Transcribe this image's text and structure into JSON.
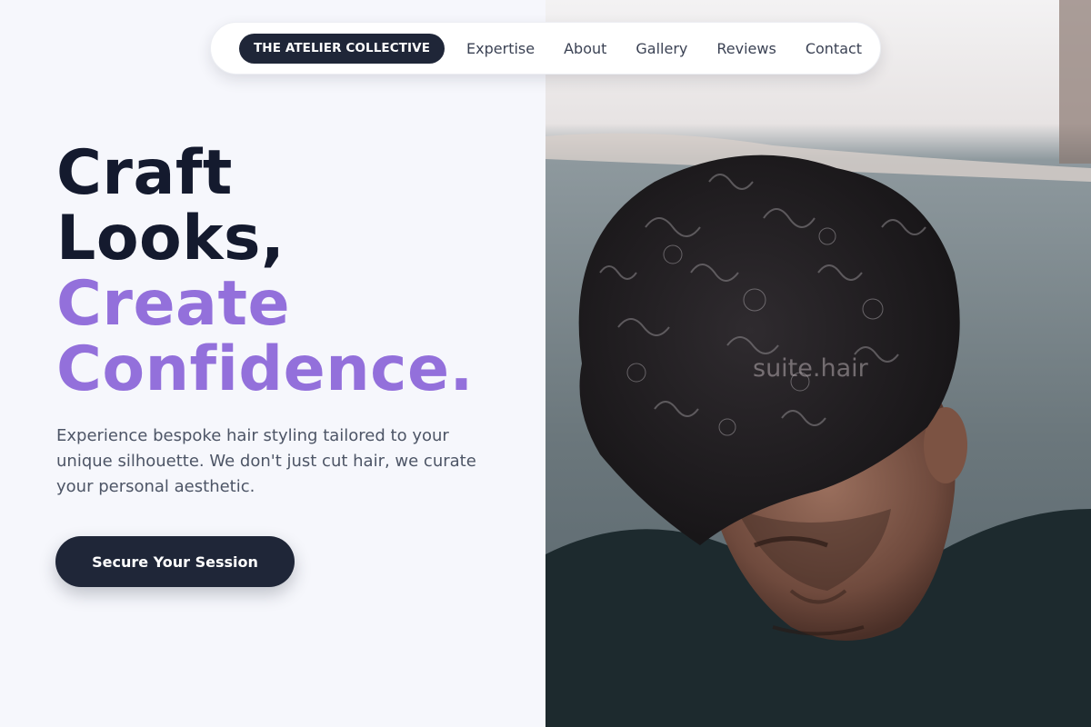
{
  "nav": {
    "brand": "THE ATELIER COLLECTIVE",
    "links": [
      "Expertise",
      "About",
      "Gallery",
      "Reviews",
      "Contact"
    ]
  },
  "hero": {
    "headline": {
      "line1": "Craft",
      "line2": "Looks,",
      "line3": "Create",
      "line4": "Confidence."
    },
    "description": "Experience bespoke hair styling tailored to your unique silhouette. We don't just cut hair, we curate your personal aesthetic.",
    "cta_label": "Secure Your Session"
  },
  "photo": {
    "watermark": "suite.hair"
  },
  "colors": {
    "background": "#f6f7fc",
    "dark": "#141a2e",
    "accent": "#9370db",
    "button": "#1f2638"
  }
}
